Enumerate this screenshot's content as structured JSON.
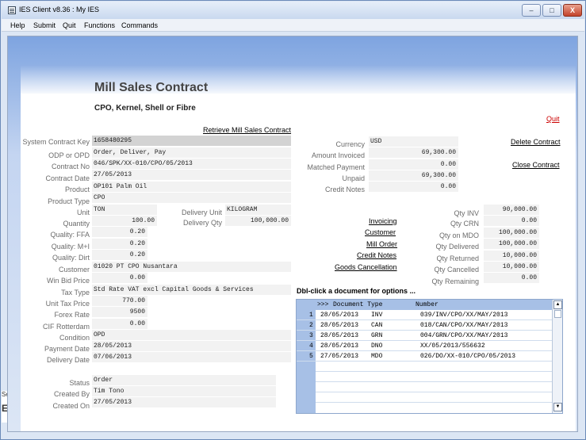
{
  "window": {
    "title": "IES Client v8.36 : My IES",
    "controls": {
      "minimize": "–",
      "maximize": "□",
      "close": "X"
    }
  },
  "menu": [
    "Help",
    "Submit",
    "Quit",
    "Functions",
    "Commands"
  ],
  "page": {
    "title": "Mill Sales Contract",
    "subtitle": "CPO, Kernel, Shell or Fibre",
    "quit": "Quit",
    "retrieve": "Retrieve Mill Sales Contract"
  },
  "form": {
    "system_contract_key": {
      "label": "System Contract Key",
      "value": "1658480295"
    },
    "odp_or_opd": {
      "label": "ODP or OPD",
      "value": "Order, Deliver, Pay"
    },
    "contract_no": {
      "label": "Contract No",
      "value": "046/SPK/XX-010/CPO/05/2013"
    },
    "contract_date": {
      "label": "Contract Date",
      "value": "27/05/2013"
    },
    "product": {
      "label": "Product",
      "value": "OP101 Palm Oil"
    },
    "product_type": {
      "label": "Product Type",
      "value": "CPO"
    },
    "unit": {
      "label": "Unit",
      "value": "TON"
    },
    "delivery_unit": {
      "label": "Delivery Unit",
      "value": "KILOGRAM"
    },
    "quantity": {
      "label": "Quantity",
      "value": "100.00"
    },
    "delivery_qty": {
      "label": "Delivery Qty",
      "value": "100,000.00"
    },
    "quality_ffa": {
      "label": "Quality: FFA",
      "value": "0.20"
    },
    "quality_mi": {
      "label": "Quality: M+I",
      "value": "0.20"
    },
    "quality_dirt": {
      "label": "Quality: Dirt",
      "value": "0.20"
    },
    "customer": {
      "label": "Customer",
      "value": "01020 PT CPO Nusantara"
    },
    "win_bid_price": {
      "label": "Win Bid Price",
      "value": "0.00"
    },
    "tax_type": {
      "label": "Tax Type",
      "value": "Std Rate VAT excl Capital Goods & Services"
    },
    "unit_tax_price": {
      "label": "Unit Tax Price",
      "value": "770.00"
    },
    "forex_rate": {
      "label": "Forex Rate",
      "value": "9500"
    },
    "cif_rotterdam": {
      "label": "CIF Rotterdam",
      "value": "0.00"
    },
    "condition": {
      "label": "Condition",
      "value": "OPD"
    },
    "payment_date": {
      "label": "Payment Date",
      "value": "28/05/2013"
    },
    "delivery_date": {
      "label": "Delivery Date",
      "value": "07/06/2013"
    },
    "status": {
      "label": "Status",
      "value": "Order"
    },
    "created_by": {
      "label": "Created By",
      "value": "Tim Tono"
    },
    "created_on": {
      "label": "Created On",
      "value": "27/05/2013"
    }
  },
  "finance": {
    "currency": {
      "label": "Currency",
      "value": "USD"
    },
    "amount_invoiced": {
      "label": "Amount Invoiced",
      "value": "69,300.00"
    },
    "matched_payment": {
      "label": "Matched Payment",
      "value": "0.00"
    },
    "unpaid": {
      "label": "Unpaid",
      "value": "69,300.00"
    },
    "credit_notes": {
      "label": "Credit Notes",
      "value": "0.00"
    }
  },
  "actions": {
    "delete_contract": "Delete Contract",
    "close_contract": "Close Contract"
  },
  "doc_links": [
    "Invoicing",
    "Customer",
    "Mill Order",
    "Credit Notes",
    "Goods Cancellation"
  ],
  "quantities": {
    "qty_inv": {
      "label": "Qty INV",
      "value": "90,000.00"
    },
    "qty_crn": {
      "label": "Qty CRN",
      "value": "0.00"
    },
    "qty_on_mdo": {
      "label": "Qty on MDO",
      "value": "100,000.00"
    },
    "qty_delivered": {
      "label": "Qty Delivered",
      "value": "100,000.00"
    },
    "qty_returned": {
      "label": "Qty Returned",
      "value": "10,000.00"
    },
    "qty_cancelled": {
      "label": "Qty Cancelled",
      "value": "10,000.00"
    },
    "qty_remaining": {
      "label": "Qty Remaining",
      "value": "0.00"
    }
  },
  "documents": {
    "caption": "Dbl-click a document for options ...",
    "header": {
      "marker": ">>>",
      "col1": "Document Type",
      "col2": "Number"
    },
    "rows": [
      {
        "n": "1",
        "date": "28/05/2013",
        "type": "INV",
        "number": "039/INV/CPO/XX/MAY/2013"
      },
      {
        "n": "2",
        "date": "28/05/2013",
        "type": "CAN",
        "number": "018/CAN/CPO/XX/MAY/2013"
      },
      {
        "n": "3",
        "date": "28/05/2013",
        "type": "GRN",
        "number": "004/GRN/CPO/XX/MAY/2013"
      },
      {
        "n": "4",
        "date": "28/05/2013",
        "type": "DNO",
        "number": "XX/05/2013/556632"
      },
      {
        "n": "5",
        "date": "27/05/2013",
        "type": "MDO",
        "number": "026/DO/XX-010/CPO/05/2013"
      }
    ],
    "scroll_up": "▲",
    "scroll_down": "▼"
  },
  "side_fragment": {
    "label": "Ses",
    "letter": "E"
  }
}
